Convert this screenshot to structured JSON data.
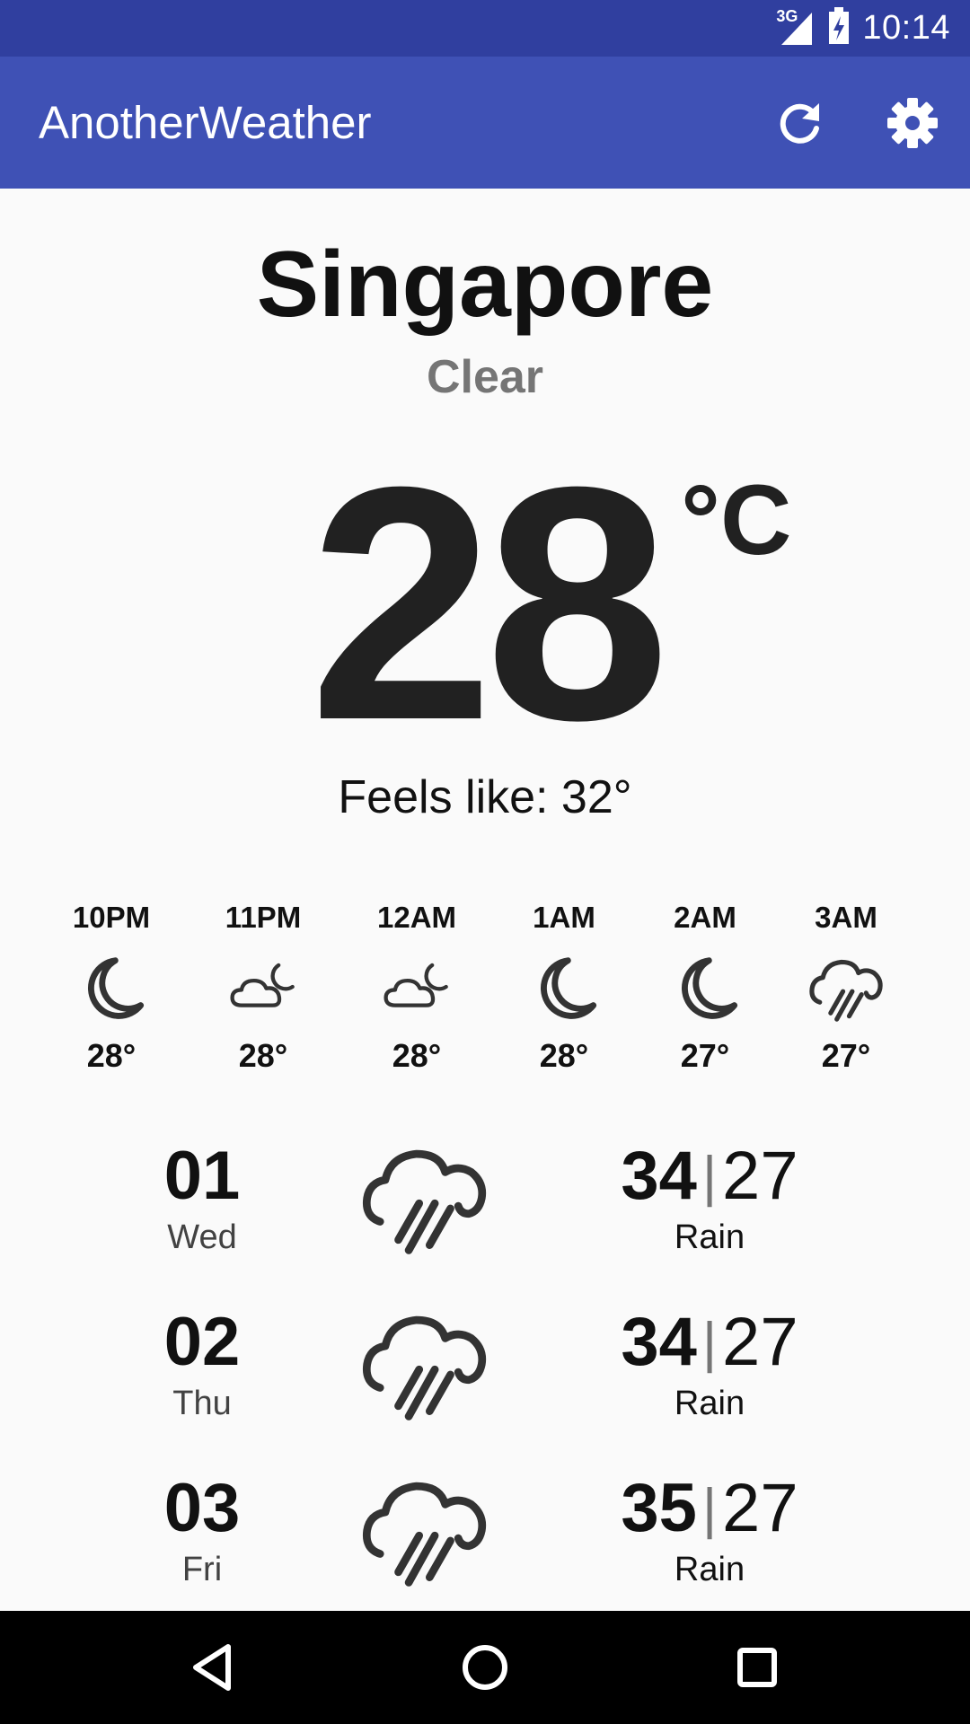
{
  "status_bar": {
    "network": "3G",
    "time": "10:14"
  },
  "app_bar": {
    "title": "AnotherWeather",
    "refresh_icon": "refresh-icon",
    "settings_icon": "settings-gear-icon"
  },
  "current": {
    "city": "Singapore",
    "condition": "Clear",
    "temperature": "28",
    "unit": "°C",
    "feels_like": "Feels like: 32°"
  },
  "hourly": [
    {
      "time": "10PM",
      "icon": "moon-icon",
      "temp": "28°"
    },
    {
      "time": "11PM",
      "icon": "cloud-moon-icon",
      "temp": "28°"
    },
    {
      "time": "12AM",
      "icon": "cloud-moon-icon",
      "temp": "28°"
    },
    {
      "time": "1AM",
      "icon": "moon-icon",
      "temp": "28°"
    },
    {
      "time": "2AM",
      "icon": "moon-icon",
      "temp": "27°"
    },
    {
      "time": "3AM",
      "icon": "rain-cloud-icon",
      "temp": "27°"
    }
  ],
  "daily": [
    {
      "day_num": "01",
      "day_name": "Wed",
      "icon": "rain-cloud-icon",
      "high": "34",
      "separator": "|",
      "low": "27",
      "condition": "Rain"
    },
    {
      "day_num": "02",
      "day_name": "Thu",
      "icon": "rain-cloud-icon",
      "high": "34",
      "separator": "|",
      "low": "27",
      "condition": "Rain"
    },
    {
      "day_num": "03",
      "day_name": "Fri",
      "icon": "rain-cloud-icon",
      "high": "35",
      "separator": "|",
      "low": "27",
      "condition": "Rain"
    }
  ],
  "nav_bar": {
    "back_icon": "back-triangle-icon",
    "home_icon": "home-circle-icon",
    "recents_icon": "recents-square-icon"
  },
  "colors": {
    "status_bar": "#303F9F",
    "app_bar": "#3F51B5",
    "background": "#FAFAFA",
    "text": "#212121",
    "secondary_text": "#757575"
  }
}
